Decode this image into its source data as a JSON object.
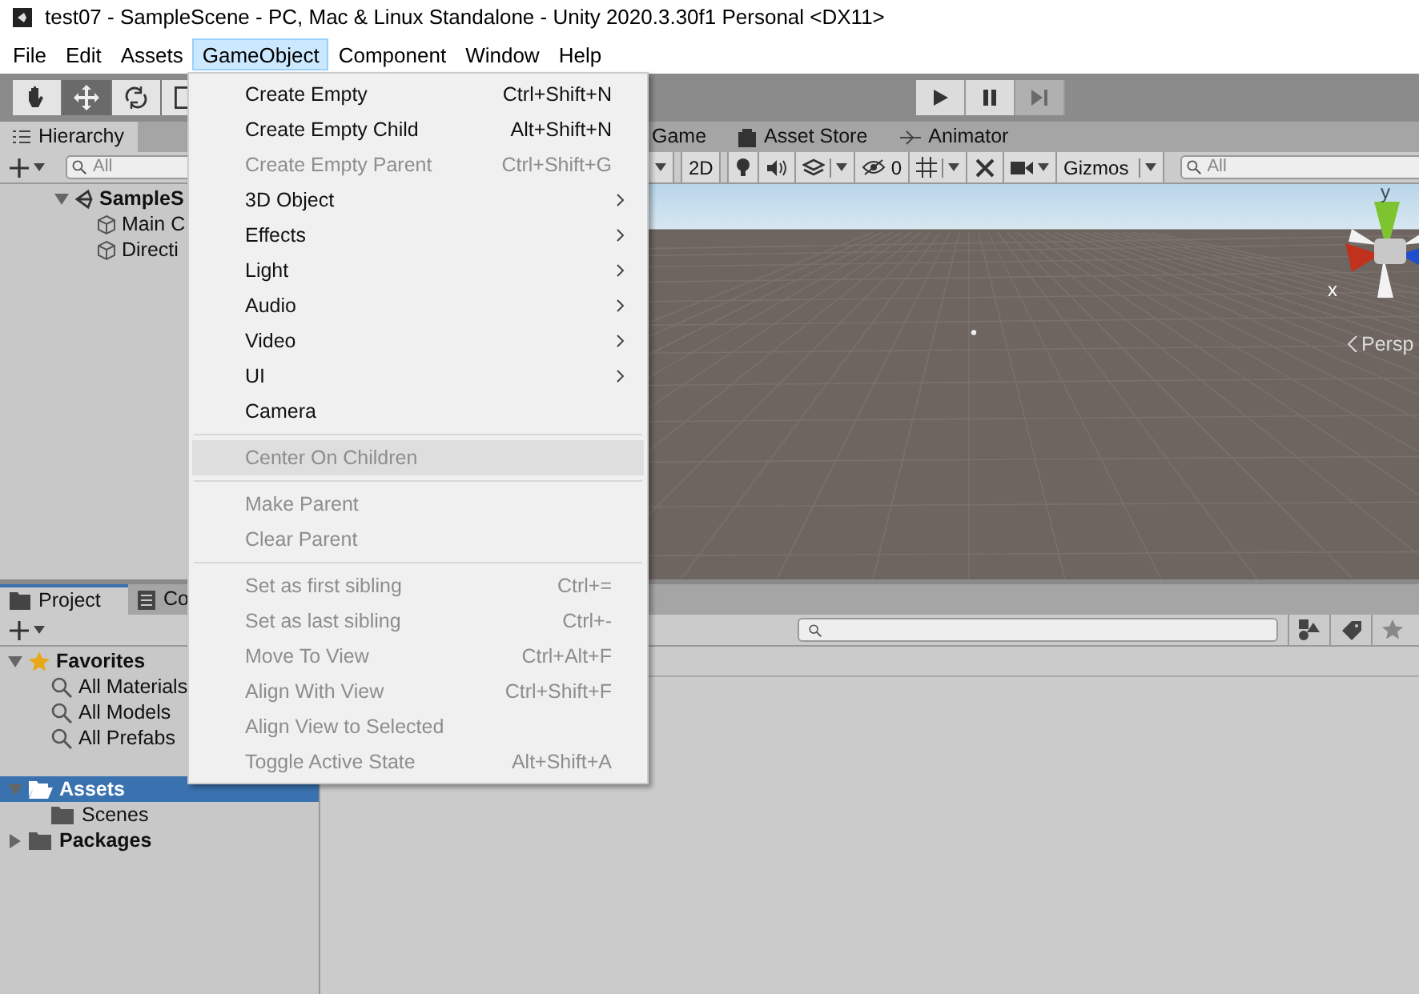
{
  "window": {
    "title": "test07 - SampleScene - PC, Mac & Linux Standalone - Unity 2020.3.30f1 Personal <DX11>"
  },
  "menubar": [
    {
      "label": "File",
      "selected": false
    },
    {
      "label": "Edit",
      "selected": false
    },
    {
      "label": "Assets",
      "selected": false
    },
    {
      "label": "GameObject",
      "selected": true
    },
    {
      "label": "Component",
      "selected": false
    },
    {
      "label": "Window",
      "selected": false
    },
    {
      "label": "Help",
      "selected": false
    }
  ],
  "toolbar": {
    "tools": [
      {
        "kind": "hand",
        "selected": false
      },
      {
        "kind": "move",
        "selected": true
      },
      {
        "kind": "rotate",
        "selected": false
      },
      {
        "kind": "scale",
        "selected": false
      }
    ],
    "play": [
      {
        "kind": "play",
        "disabled": false
      },
      {
        "kind": "pause",
        "disabled": false
      },
      {
        "kind": "step",
        "disabled": true
      }
    ]
  },
  "hierarchy": {
    "tab": "Hierarchy",
    "search": {
      "placeholder": "All"
    },
    "items": [
      {
        "label": "SampleS",
        "kind": "scene",
        "expanded": true,
        "children": [
          {
            "label": "Main C",
            "kind": "object"
          },
          {
            "label": "Directi",
            "kind": "object"
          }
        ]
      }
    ]
  },
  "scene": {
    "tabs": [
      {
        "label": "Game",
        "kind": "game",
        "selected": false
      },
      {
        "label": "Asset Store",
        "kind": "store",
        "selected": false
      },
      {
        "label": "Animator",
        "kind": "animator",
        "selected": false
      }
    ],
    "toolbar": {
      "mode_2d": "2D",
      "hidden_count": "0",
      "gizmos": "Gizmos",
      "search": {
        "placeholder": "All"
      }
    },
    "gizmo": {
      "y_label": "y",
      "x_label": "x",
      "projection": "Persp"
    }
  },
  "project": {
    "tabs": [
      {
        "label": "Project",
        "kind": "project",
        "selected": true
      },
      {
        "label": "Co",
        "kind": "console",
        "selected": false
      }
    ],
    "tree": [
      {
        "label": "Favorites",
        "kind": "favorites",
        "selected": false,
        "expanded": true,
        "children": [
          {
            "label": "All Materials",
            "kind": "search"
          },
          {
            "label": "All Models",
            "kind": "search"
          },
          {
            "label": "All Prefabs",
            "kind": "search"
          }
        ]
      },
      {
        "label": "Assets",
        "kind": "folder",
        "selected": true,
        "expanded": true,
        "children": [
          {
            "label": "Scenes",
            "kind": "folder"
          }
        ]
      },
      {
        "label": "Packages",
        "kind": "folder",
        "selected": false,
        "expanded": false
      }
    ]
  },
  "menu": [
    {
      "kind": "item",
      "label": "Create Empty",
      "shortcut": "Ctrl+Shift+N",
      "disabled": false,
      "highlighted": false
    },
    {
      "kind": "item",
      "label": "Create Empty Child",
      "shortcut": "Alt+Shift+N",
      "disabled": false,
      "highlighted": false
    },
    {
      "kind": "item",
      "label": "Create Empty Parent",
      "shortcut": "Ctrl+Shift+G",
      "disabled": true,
      "highlighted": false
    },
    {
      "kind": "submenu",
      "label": "3D Object",
      "disabled": false,
      "highlighted": false
    },
    {
      "kind": "submenu",
      "label": "Effects",
      "disabled": false,
      "highlighted": false
    },
    {
      "kind": "submenu",
      "label": "Light",
      "disabled": false,
      "highlighted": false
    },
    {
      "kind": "submenu",
      "label": "Audio",
      "disabled": false,
      "highlighted": false
    },
    {
      "kind": "submenu",
      "label": "Video",
      "disabled": false,
      "highlighted": false
    },
    {
      "kind": "submenu",
      "label": "UI",
      "disabled": false,
      "highlighted": false
    },
    {
      "kind": "item",
      "label": "Camera",
      "disabled": false,
      "highlighted": false
    },
    {
      "kind": "separator"
    },
    {
      "kind": "item",
      "label": "Center On Children",
      "disabled": true,
      "highlighted": true
    },
    {
      "kind": "separator"
    },
    {
      "kind": "item",
      "label": "Make Parent",
      "disabled": true,
      "highlighted": false
    },
    {
      "kind": "item",
      "label": "Clear Parent",
      "disabled": true,
      "highlighted": false
    },
    {
      "kind": "separator"
    },
    {
      "kind": "item",
      "label": "Set as first sibling",
      "shortcut": "Ctrl+=",
      "disabled": true,
      "highlighted": false
    },
    {
      "kind": "item",
      "label": "Set as last sibling",
      "shortcut": "Ctrl+-",
      "disabled": true,
      "highlighted": false
    },
    {
      "kind": "item",
      "label": "Move To View",
      "shortcut": "Ctrl+Alt+F",
      "disabled": true,
      "highlighted": false
    },
    {
      "kind": "item",
      "label": "Align With View",
      "shortcut": "Ctrl+Shift+F",
      "disabled": true,
      "highlighted": false
    },
    {
      "kind": "item",
      "label": "Align View to Selected",
      "disabled": true,
      "highlighted": false
    },
    {
      "kind": "item",
      "label": "Toggle Active State",
      "shortcut": "Alt+Shift+A",
      "disabled": true,
      "highlighted": false
    }
  ]
}
